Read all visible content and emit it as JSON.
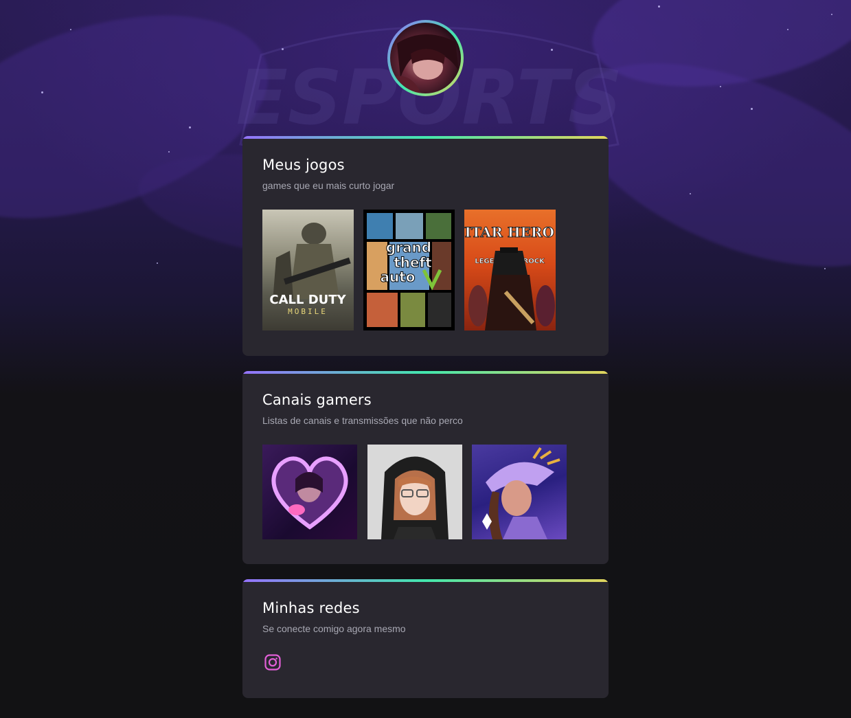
{
  "profile": {
    "avatar_icon": "user-avatar"
  },
  "background": {
    "watermark_text": "ESPORTS"
  },
  "sections": [
    {
      "title": "Meus jogos",
      "subtitle": "games que eu mais curto jogar",
      "items": [
        {
          "name": "game-cover-call-of-duty",
          "label_top": "CALL DUTY",
          "label_bottom": "MOBILE"
        },
        {
          "name": "game-cover-gta-v",
          "label_top": "grand",
          "label_mid": "theft",
          "label_bottom": "auto"
        },
        {
          "name": "game-cover-guitar-hero-3",
          "label_top": "GUITAR HERO III",
          "label_bottom": "LEGENDS of ROCK"
        }
      ]
    },
    {
      "title": "Canais gamers",
      "subtitle": "Listas de canais e transmissões que não perco",
      "items": [
        {
          "name": "channel-thumb-1"
        },
        {
          "name": "channel-thumb-2"
        },
        {
          "name": "channel-thumb-3"
        }
      ]
    },
    {
      "title": "Minhas redes",
      "subtitle": "Se conecte comigo agora mesmo",
      "items": [
        {
          "name": "instagram-link",
          "icon": "instagram-icon"
        }
      ]
    }
  ],
  "colors": {
    "gradient_start": "#9572fc",
    "gradient_mid": "#43e7ad",
    "gradient_end": "#e2d45c",
    "card_bg": "#29272f",
    "page_bg": "#121214",
    "instagram": "#e25fd7"
  }
}
